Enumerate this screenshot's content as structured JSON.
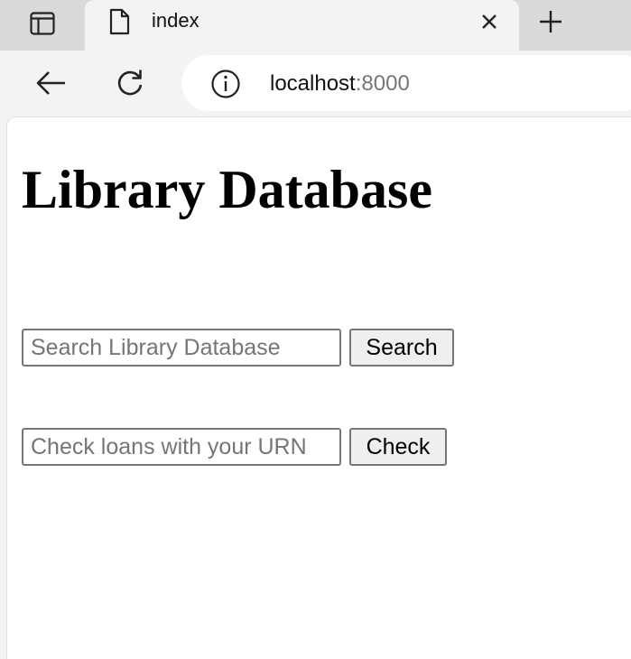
{
  "browser": {
    "tab": {
      "title": "index",
      "page_icon": "page-icon",
      "close_icon": "close-icon"
    },
    "tab_actions_icon": "tab-actions-icon",
    "new_tab_icon": "plus-icon",
    "toolbar": {
      "back_icon": "back-arrow-icon",
      "refresh_icon": "refresh-icon",
      "info_icon": "info-icon",
      "url_host": "localhost",
      "url_port": ":8000"
    }
  },
  "page": {
    "title": "Library Database",
    "search": {
      "placeholder": "Search Library Database",
      "value": "",
      "button_label": "Search"
    },
    "loans": {
      "placeholder": "Check loans with your URN",
      "value": "",
      "button_label": "Check"
    }
  }
}
